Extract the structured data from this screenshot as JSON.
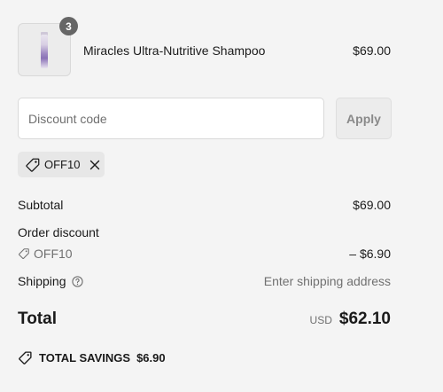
{
  "product": {
    "name": "Miracles Ultra-Nutritive Shampoo",
    "price": "$69.00",
    "quantity": "3"
  },
  "discount_form": {
    "placeholder": "Discount code",
    "apply_label": "Apply"
  },
  "applied_code": {
    "code": "OFF10",
    "icon": "tag-icon",
    "remove_icon": "close-icon"
  },
  "summary": {
    "subtotal_label": "Subtotal",
    "subtotal_value": "$69.00",
    "order_discount_label": "Order discount",
    "discount_code": "OFF10",
    "discount_amount": "– $6.90",
    "shipping_label": "Shipping",
    "shipping_value": "Enter shipping address",
    "total_label": "Total",
    "currency": "USD",
    "total_amount": "$62.10"
  },
  "savings": {
    "label": "TOTAL SAVINGS",
    "amount": "$6.90"
  },
  "colors": {
    "background": "#f4f4f4",
    "badge": "#666666",
    "muted_text": "#707070"
  }
}
